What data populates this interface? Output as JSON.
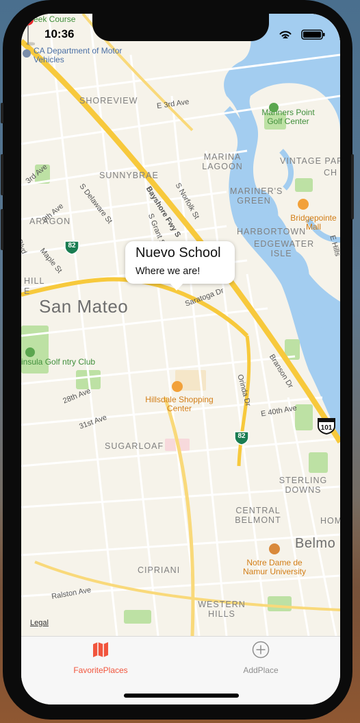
{
  "status_bar": {
    "time": "10:36"
  },
  "map": {
    "cities": [
      "San Mateo"
    ],
    "districts": [
      "SHOREVIEW",
      "SUNNYBRAE",
      "ARAGON",
      "MARINA LAGOON",
      "VINTAGE PARK",
      "MARINER'S GREEN",
      "HARBORTOWN",
      "EDGEWATER ISLE",
      "SUGARLOAF",
      "STERLING DOWNS",
      "CENTRAL BELMONT",
      "CIPRIANI",
      "WESTERN HILLS",
      "HOME",
      "CH",
      "Belmo",
      "HILL",
      "E"
    ],
    "streets": [
      "E 3rd Ave",
      "3rd Ave",
      "9th Ave",
      "S Delaware St",
      "Bayshore Fwy S",
      "S Norfolk St",
      "S Grant St",
      "Maple St",
      "Blvd",
      "Saratoga Dr",
      "28th Ave",
      "31st Ave",
      "Orinda Dr",
      "Branson Dr",
      "E 40th Ave",
      "Ralston Ave",
      "E Hills"
    ],
    "pois": [
      "Bridgepointe Mall",
      "Hillsdale Shopping Center",
      "Notre Dame de Namur University",
      "CA Department of Motor Vehicles"
    ],
    "parks": [
      "Mariners Point Golf Center",
      "insula Golf ntry Club",
      "reek Course"
    ],
    "route_shields": [
      "82",
      "82",
      "101"
    ],
    "legal": "Legal"
  },
  "callout": {
    "title": "Nuevo School",
    "subtitle": "Where we are!"
  },
  "tabs": [
    {
      "label": "FavoritePlaces",
      "icon": "map-icon",
      "selected": true,
      "color": "#f1553d"
    },
    {
      "label": "AddPlace",
      "icon": "plus-circle-icon",
      "selected": false,
      "color": "#8e8e8e"
    }
  ],
  "colors": {
    "water": "#a3cdf0",
    "park": "#bde1a4",
    "highway": "#f7c93c",
    "pin": "#e8262a",
    "accent": "#f1553d"
  }
}
